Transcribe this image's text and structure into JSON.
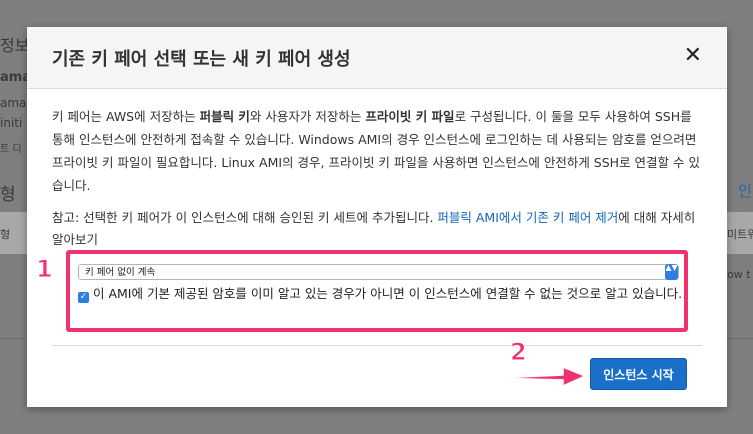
{
  "background": {
    "fragments": [
      "정보",
      "ama:",
      "amaz",
      "initi",
      "트 디",
      "형",
      "형",
      "인",
      "미트워",
      "ow t"
    ]
  },
  "modal": {
    "title": "기존 키 페어 선택 또는 새 키 페어 생성",
    "close_symbol": "✕",
    "intro": {
      "p1": "키 페어는 AWS에 저장하는 ",
      "b1": "퍼블릭 키",
      "p2": "와 사용자가 저장하는 ",
      "b2": "프라이빗 키 파일",
      "p3": "로 구성됩니다. 이 둘을 모두 사용하여 SSH를 통해 인스턴스에 안전하게 접속할 수 있습니다. Windows AMI의 경우 인스턴스에 로그인하는 데 사용되는 암호를 얻으려면 프라이빗 키 파일이 필요합니다. Linux AMI의 경우, 프라이빗 키 파일을 사용하면 인스턴스에 안전하게 SSH로 연결할 수 있습니다."
    },
    "note": {
      "prefix": "참고: 선택한 키 페어가 이 인스턴스에 대해 승인된 키 세트에 추가됩니다. ",
      "link": "퍼블릭 AMI에서 기존 키 페어 제거",
      "suffix": "에 대해 자세히 알아보기"
    },
    "select_value": "키 페어 없이 계속",
    "select_arrow": "▲▼",
    "checkbox_label": "이 AMI에 기본 제공된 암호를 이미 알고 있는 경우가 아니면 이 인스턴스에 연결할 수 없는 것으로 알고 있습니다.",
    "checkbox_checked": true,
    "launch_button": "인스턴스 시작"
  },
  "annotations": {
    "step1": "1",
    "step2": "2",
    "color": "#f0336e"
  }
}
